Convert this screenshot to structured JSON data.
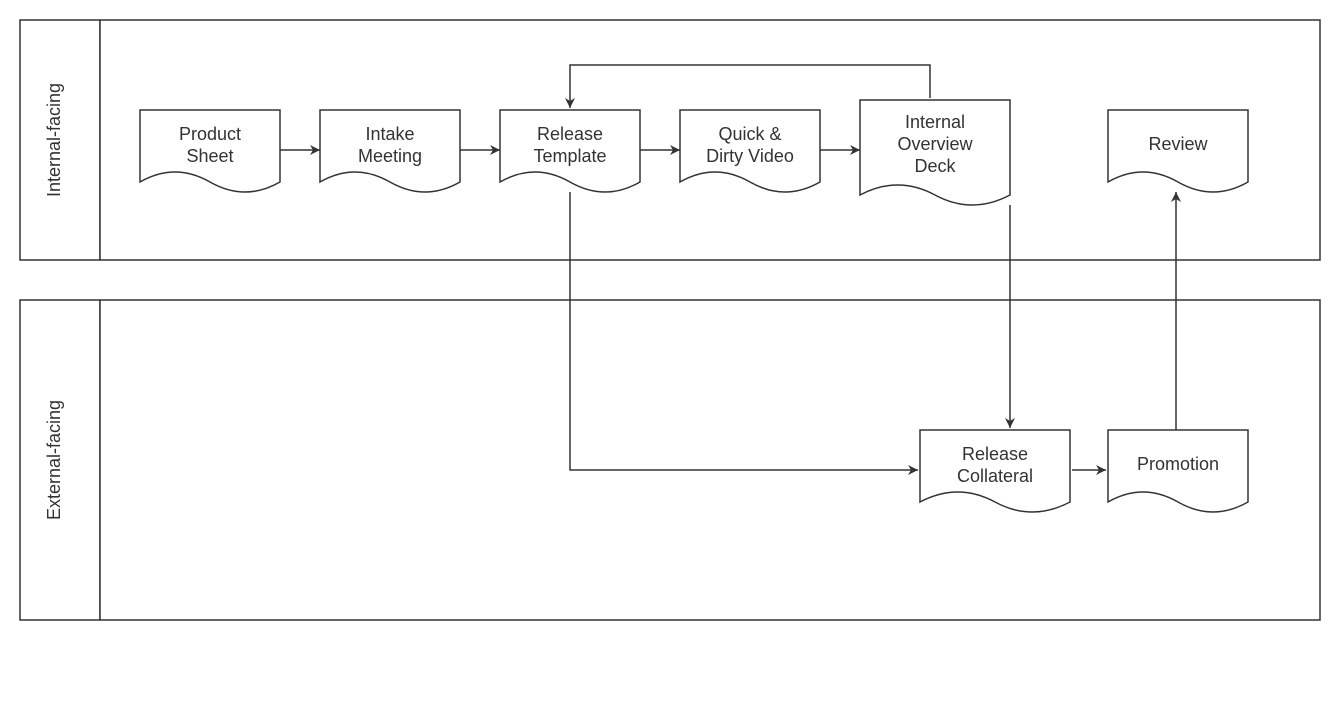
{
  "lanes": {
    "internal": {
      "label": "Internal-facing"
    },
    "external": {
      "label": "External-facing"
    }
  },
  "nodes": {
    "product_sheet": {
      "line1": "Product",
      "line2": "Sheet"
    },
    "intake_meeting": {
      "line1": "Intake",
      "line2": "Meeting"
    },
    "release_template": {
      "line1": "Release",
      "line2": "Template"
    },
    "quick_dirty": {
      "line1": "Quick &",
      "line2": "Dirty Video"
    },
    "overview_deck": {
      "line1": "Internal",
      "line2": "Overview",
      "line3": "Deck"
    },
    "review": {
      "line1": "Review"
    },
    "release_collateral": {
      "line1": "Release",
      "line2": "Collateral"
    },
    "promotion": {
      "line1": "Promotion"
    }
  },
  "connections": [
    {
      "from": "product_sheet",
      "to": "intake_meeting"
    },
    {
      "from": "intake_meeting",
      "to": "release_template"
    },
    {
      "from": "release_template",
      "to": "quick_dirty"
    },
    {
      "from": "quick_dirty",
      "to": "overview_deck"
    },
    {
      "from": "overview_deck",
      "to": "release_template",
      "note": "loop back via top"
    },
    {
      "from": "release_template",
      "to": "release_collateral",
      "note": "down then right"
    },
    {
      "from": "overview_deck",
      "to": "release_collateral",
      "note": "vertical down"
    },
    {
      "from": "release_collateral",
      "to": "promotion"
    },
    {
      "from": "promotion",
      "to": "review",
      "note": "vertical up"
    }
  ]
}
